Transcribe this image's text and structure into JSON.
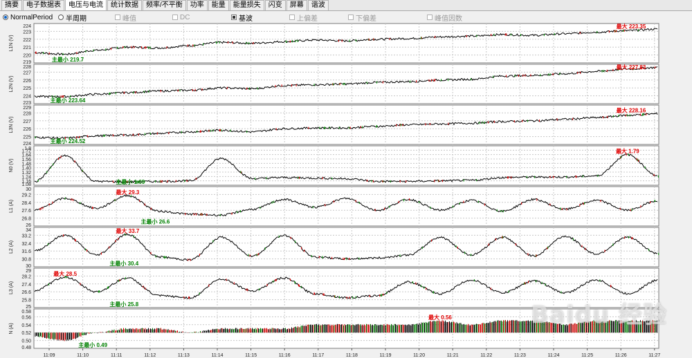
{
  "tabs": [
    {
      "label": "摘要",
      "active": false
    },
    {
      "label": "电子数据表",
      "active": false
    },
    {
      "label": "电压与电流",
      "active": true
    },
    {
      "label": "统计数据",
      "active": false
    },
    {
      "label": "频率/不平衡",
      "active": false
    },
    {
      "label": "功率",
      "active": false
    },
    {
      "label": "能量",
      "active": false
    },
    {
      "label": "能量损失",
      "active": false
    },
    {
      "label": "闪变",
      "active": false
    },
    {
      "label": "屏幕",
      "active": false
    },
    {
      "label": "谐波",
      "active": false
    }
  ],
  "toolbar": {
    "mode": "NormalPeriod",
    "options": [
      {
        "label": "半周期",
        "type": "radio",
        "checked": false,
        "enabled": true
      },
      {
        "label": "峰值",
        "type": "check",
        "checked": false,
        "enabled": false
      },
      {
        "label": "DC",
        "type": "check",
        "checked": false,
        "enabled": false
      },
      {
        "label": "基波",
        "type": "check",
        "checked": true,
        "enabled": true
      },
      {
        "label": "上偏差",
        "type": "check",
        "checked": false,
        "enabled": false
      },
      {
        "label": "下偏差",
        "type": "check",
        "checked": false,
        "enabled": false
      },
      {
        "label": "峰值因数",
        "type": "check",
        "checked": false,
        "enabled": false
      }
    ]
  },
  "watermark": "Baidu 经验",
  "chart_data": [
    {
      "type": "line",
      "ylabel": "L1N (V)",
      "ylim": [
        219,
        224
      ],
      "ticks": [
        "224",
        "223",
        "222",
        "221",
        "220",
        "219"
      ],
      "max_label": "最大 223.35",
      "min_label": "主最小 219.7",
      "series": [
        {
          "values": [
            220.3,
            220.1,
            220.6,
            221.0,
            220.9,
            221.2,
            221.6,
            221.5,
            221.7,
            221.9,
            221.8,
            222.0,
            222.1,
            222.3,
            222.4,
            222.6,
            222.5,
            222.7,
            222.9,
            223.1,
            223.3
          ]
        }
      ],
      "colors": {
        "line": "#000000",
        "max": "#e00000",
        "min": "#008000"
      }
    },
    {
      "type": "line",
      "ylabel": "L2N (V)",
      "ylim": [
        223,
        228
      ],
      "ticks": [
        "228",
        "227",
        "226",
        "225",
        "224",
        "223"
      ],
      "max_label": "最大 227.83",
      "min_label": "主最小 223.64",
      "series": [
        {
          "values": [
            223.9,
            223.9,
            224.2,
            224.4,
            224.6,
            224.7,
            225.0,
            224.9,
            225.3,
            225.4,
            225.5,
            225.7,
            225.8,
            226.0,
            226.1,
            226.5,
            226.6,
            226.8,
            227.1,
            227.4,
            227.6
          ]
        }
      ],
      "colors": {
        "line": "#000000",
        "max": "#e00000",
        "min": "#008000"
      }
    },
    {
      "type": "line",
      "ylabel": "L3N (V)",
      "ylim": [
        224,
        229
      ],
      "ticks": [
        "229",
        "228",
        "227",
        "226",
        "225",
        "224"
      ],
      "max_label": "最大 228.16",
      "min_label": "主最小 224.52",
      "series": [
        {
          "values": [
            224.9,
            224.8,
            225.1,
            225.2,
            225.4,
            225.6,
            225.8,
            225.6,
            226.0,
            226.1,
            226.1,
            226.3,
            226.5,
            226.6,
            226.7,
            226.9,
            227.0,
            227.2,
            227.4,
            227.7,
            227.9
          ]
        }
      ],
      "colors": {
        "line": "#000000",
        "max": "#e00000",
        "min": "#008000"
      }
    },
    {
      "type": "line",
      "ylabel": "N0 (V)",
      "ylim": [
        1.08,
        1.8
      ],
      "ticks": [
        "1.8",
        "1.72",
        "1.64",
        "1.56",
        "1.48",
        "1.40",
        "1.32",
        "1.24",
        "1.16",
        "1.08"
      ],
      "max_label": "最大 1.79",
      "min_label": "主最小 1.09",
      "series": [
        {
          "values": [
            1.14,
            1.62,
            1.15,
            1.14,
            1.15,
            1.16,
            1.57,
            1.2,
            1.22,
            1.21,
            1.2,
            1.15,
            1.15,
            1.16,
            1.17,
            1.22,
            1.23,
            1.23,
            1.25,
            1.64,
            1.24
          ]
        }
      ],
      "colors": {
        "line": "#000000",
        "max": "#e00000",
        "min": "#008000"
      }
    },
    {
      "type": "line",
      "ylabel": "L1 (A)",
      "ylim": [
        26,
        30
      ],
      "ticks": [
        "30",
        "29.2",
        "28.4",
        "27.6",
        "26.8",
        "26"
      ],
      "max_label": "最大 29.3",
      "min_label": "主最小 26.6",
      "series": [
        {
          "values": [
            27.6,
            28.8,
            27.8,
            29.1,
            27.5,
            27.2,
            27.1,
            27.7,
            28.7,
            27.9,
            28.8,
            27.6,
            28.7,
            27.6,
            28.6,
            27.5,
            28.7,
            27.7,
            28.6,
            27.6,
            28.6
          ]
        }
      ],
      "colors": {
        "line": "#000000",
        "max": "#e00000",
        "min": "#008000"
      }
    },
    {
      "type": "line",
      "ylabel": "L2 (A)",
      "ylim": [
        30,
        34
      ],
      "ticks": [
        "34",
        "33.2",
        "32.4",
        "31.6",
        "30.8",
        "30"
      ],
      "max_label": "最大 33.7",
      "min_label": "主最小 30.4",
      "series": [
        {
          "values": [
            31.6,
            33.2,
            31.2,
            33.3,
            31.0,
            30.7,
            33.0,
            31.1,
            33.2,
            31.0,
            30.8,
            30.9,
            31.2,
            33.0,
            31.2,
            33.0,
            31.1,
            33.1,
            31.3,
            33.0,
            31.3
          ]
        }
      ],
      "colors": {
        "line": "#000000",
        "max": "#e00000",
        "min": "#008000"
      }
    },
    {
      "type": "line",
      "ylabel": "L3 (A)",
      "ylim": [
        25,
        29
      ],
      "ticks": [
        "29",
        "28.2",
        "27.4",
        "26.6",
        "25.8",
        "25"
      ],
      "max_label": "最大 28.5",
      "min_label": "主最小 25.8",
      "series": [
        {
          "values": [
            26.7,
            28.1,
            26.6,
            28.0,
            26.2,
            26.0,
            27.9,
            26.7,
            28.0,
            26.4,
            26.0,
            26.2,
            27.6,
            26.4,
            27.8,
            26.5,
            27.7,
            26.5,
            27.8,
            26.4,
            27.8
          ]
        }
      ],
      "colors": {
        "line": "#000000",
        "max": "#e00000",
        "min": "#008000"
      }
    },
    {
      "type": "bar",
      "ylabel": "N (A)",
      "ylim": [
        0.48,
        0.58
      ],
      "ticks": [
        "0.58",
        "0.56",
        "0.54",
        "0.52",
        "0.50",
        "0.48"
      ],
      "max_label": "最大 0.56",
      "min_label": "主最小 0.49",
      "series": [
        {
          "values": [
            0.51,
            0.5,
            0.52,
            0.53,
            0.53,
            0.52,
            0.53,
            0.53,
            0.53,
            0.54,
            0.54,
            0.54,
            0.54,
            0.55,
            0.54,
            0.55,
            0.55,
            0.54,
            0.55,
            0.55,
            0.55
          ]
        }
      ],
      "colors": {
        "line": "#000000",
        "max": "#e00000",
        "min": "#008000"
      }
    }
  ],
  "x_ticks": [
    "11:09",
    "11:10",
    "11:11",
    "11:12",
    "11:13",
    "11:14",
    "11:15",
    "11:16",
    "11:17",
    "11:18",
    "11:19",
    "11:20",
    "11:21",
    "11:22",
    "11:23",
    "11:24",
    "11:25",
    "11:26",
    "11:27"
  ]
}
